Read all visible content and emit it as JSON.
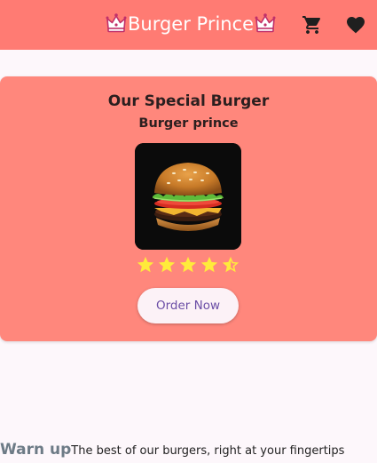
{
  "appbar": {
    "title": "Burger Prince",
    "background": "#ff7b73",
    "actions": [
      {
        "icon": "shopping-cart-icon"
      },
      {
        "icon": "heart-icon"
      }
    ]
  },
  "card": {
    "title": "Our Special Burger",
    "subtitle": "Burger prince",
    "image_alt": "burger",
    "rating": 4.5,
    "rating_max": 5,
    "order_label": "Order Now",
    "background": "#ff877c"
  },
  "bottom": {
    "heading": "Warn up",
    "tagline": "The best of our burgers, right at your fingertips"
  }
}
